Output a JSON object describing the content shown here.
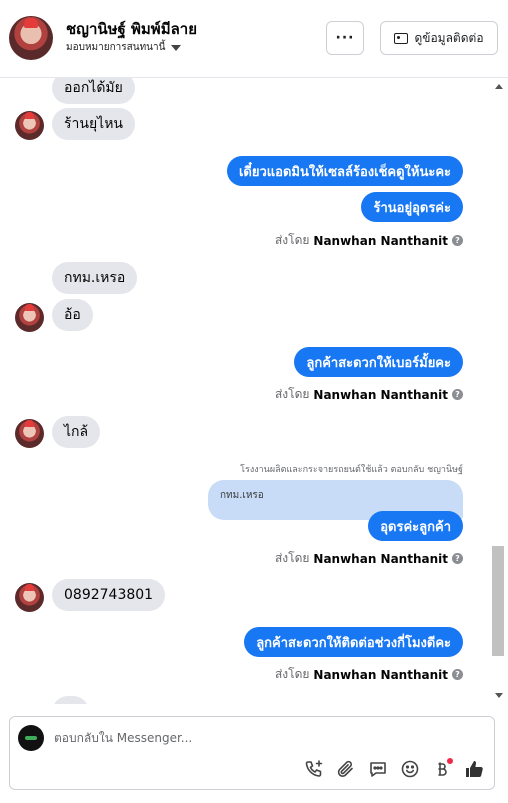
{
  "header": {
    "contact_name": "ชญานิษฐ์ พิมพ์มีลาย",
    "assign_label": "มอบหมายการสนทนานี้",
    "more_label": "···",
    "contact_info_label": "ดูข้อมูลติดต่อ"
  },
  "messages": {
    "m1": "ออกได้มัย",
    "m2": "ร้านยุไหน",
    "m3": "เดี๋ยวแอดมินให้เซลล์ร้องเช็คดูให้นะคะ",
    "m4": "ร้านอยู่อุดรค่ะ",
    "m5": "กทม.เหรอ",
    "m6": "อ้อ",
    "m7": "ลูกค้าสะดวกให้เบอร์มั้ยคะ",
    "m8": "ไกล้",
    "m9_quote_note": "โรงงานผลิตและกระจายรถยนต์ใช้แล้ว ตอบกลับ ชญานิษฐ์",
    "m9_quoted": "กทม.เหรอ",
    "m9": "อุดรค่ะลูกค้า",
    "m10": "0892743801",
    "m11": "ลูกค้าสะดวกให้ติดต่อช่วงกี่โมงดีคะ",
    "m12_partial": "..."
  },
  "sent_by": {
    "prefix": "ส่งโดย",
    "agent": "Nanwhan Nanthanit",
    "help": "?"
  },
  "composer": {
    "placeholder": "ตอบกลับใน Messenger..."
  },
  "icons": [
    "more-icon",
    "contact-card-icon",
    "chevron-down-icon",
    "help-icon",
    "call-add-icon",
    "attach-icon",
    "saved-reply-icon",
    "emoji-icon",
    "payment-icon",
    "like-icon"
  ],
  "colors": {
    "outgoing": "#1877f2",
    "incoming": "#e4e6eb",
    "quoted": "#c9dcf7",
    "notification_dot": "#f02849"
  }
}
